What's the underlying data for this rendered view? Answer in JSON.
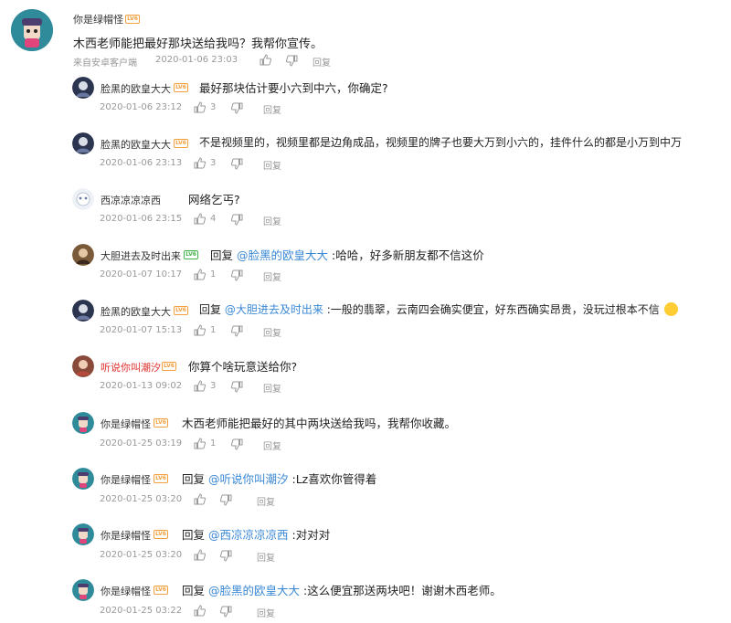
{
  "main_comment": {
    "user": "你是绿帽怪",
    "text": "木西老师能把最好那块送给我吗？我帮你宣传。",
    "source": "来自安卓客户端",
    "time": "2020-01-06 23:03",
    "reply_label": "回复"
  },
  "replies": [
    {
      "user": "脸黑的欧皇大大",
      "text": "最好那块估计要小六到中六，你确定?",
      "time": "2020-01-06 23:12",
      "likes": "3",
      "reply_label": "回复"
    },
    {
      "user": "脸黑的欧皇大大",
      "text": "不是视频里的，视频里都是边角成品，视频里的牌子也要大万到小六的，挂件什么的都是小万到中万",
      "time": "2020-01-06 23:13",
      "likes": "3",
      "reply_label": "回复"
    },
    {
      "user": "西凉凉凉凉西",
      "text": "网络乞丐?",
      "time": "2020-01-06 23:15",
      "likes": "4",
      "reply_label": "回复"
    },
    {
      "user": "大胆进去及时出来",
      "prefix": "回复",
      "mention": "@脸黑的欧皇大大",
      "text": ":哈哈，好多新朋友都不信这价",
      "time": "2020-01-07 10:17",
      "likes": "1",
      "reply_label": "回复"
    },
    {
      "user": "脸黑的欧皇大大",
      "prefix": "回复",
      "mention": "@大胆进去及时出来",
      "text": ":一般的翡翠，云南四会确实便宜，好东西确实昂贵，没玩过根本不信",
      "time": "2020-01-07 15:13",
      "likes": "1",
      "reply_label": "回复"
    },
    {
      "user": "听说你叫潮汐",
      "text": "你算个啥玩意送给你?",
      "time": "2020-01-13 09:02",
      "likes": "3",
      "reply_label": "回复"
    },
    {
      "user": "你是绿帽怪",
      "text": "木西老师能把最好的其中两块送给我吗，我帮你收藏。",
      "time": "2020-01-25 03:19",
      "likes": "1",
      "reply_label": "回复"
    },
    {
      "user": "你是绿帽怪",
      "prefix": "回复",
      "mention": "@听说你叫潮汐",
      "text": ":Lz喜欢你管得着",
      "time": "2020-01-25 03:20",
      "reply_label": "回复"
    },
    {
      "user": "你是绿帽怪",
      "prefix": "回复",
      "mention": "@西凉凉凉凉西",
      "text": ":对对对",
      "time": "2020-01-25 03:20",
      "reply_label": "回复"
    },
    {
      "user": "你是绿帽怪",
      "prefix": "回复",
      "mention": "@脸黑的欧皇大大",
      "text": ":这么便宜那送两块吧！谢谢木西老师。",
      "time": "2020-01-25 03:22",
      "reply_label": "回复"
    }
  ],
  "level_badge": "LV6",
  "colors": {
    "mention": "#3a88d6",
    "meta": "#999999",
    "level": "#f2a03d",
    "red_name": "#e0312e"
  }
}
